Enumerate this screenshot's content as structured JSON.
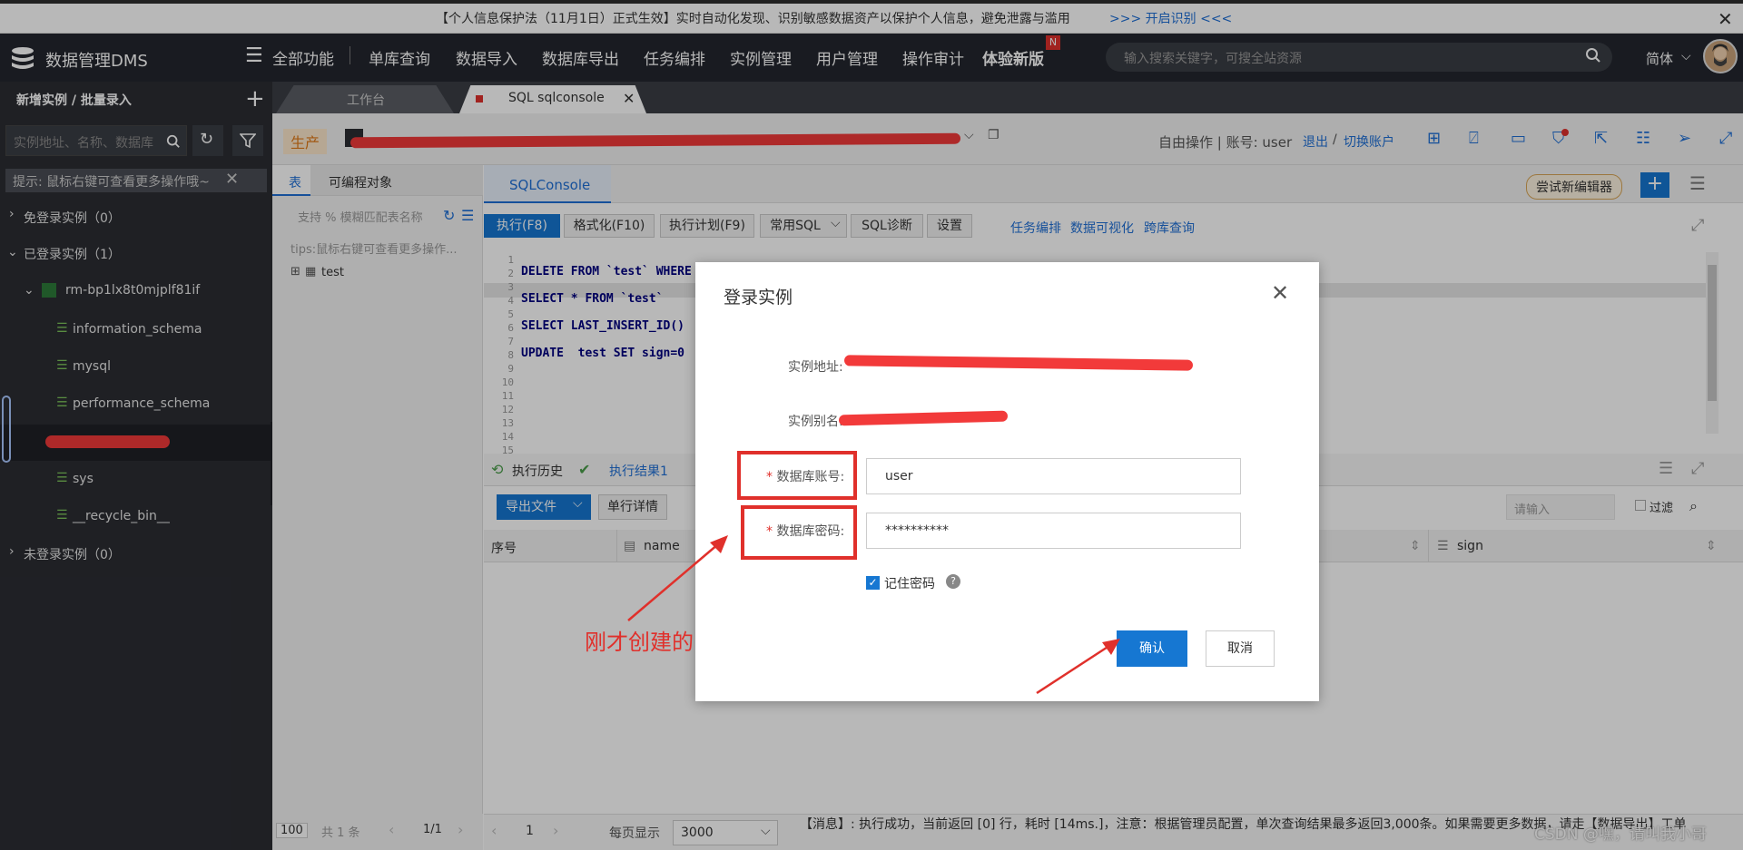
{
  "notice": {
    "text": "【个人信息保护法（11月1日）正式生效】实时自动化发现、识别敏感数据资产以保护个人信息，避免泄露与滥用",
    "link": ">>> 开启识别 <<<"
  },
  "header": {
    "app_title": "数据管理DMS",
    "all_functions": "全部功能",
    "nav": [
      "单库查询",
      "数据导入",
      "数据库导出",
      "任务编排",
      "实例管理",
      "用户管理",
      "操作审计"
    ],
    "try_new": "体验新版",
    "new_badge": "N",
    "search_placeholder": "输入搜索关键字，可搜全站资源",
    "lang": "简体"
  },
  "sidebar": {
    "title": "新增实例 / 批量录入",
    "search_placeholder": "实例地址、名称、数据库",
    "tip": "提示: 鼠标右键可查看更多操作哦~",
    "groups": [
      {
        "label": "免登录实例（0）"
      },
      {
        "label": "已登录实例（1）"
      },
      {
        "label": "未登录实例（0）"
      }
    ],
    "instance": "rm-bp1lx8t0mjplf81if",
    "databases": [
      "information_schema",
      "mysql",
      "performance_schema",
      "sys",
      "__recycle_bin__"
    ]
  },
  "tabs": {
    "workbench": "工作台",
    "sqlconsole": "SQL sqlconsole"
  },
  "infobar": {
    "env": "生产",
    "mode": "自由操作 | 账号: user",
    "logout": "退出",
    "switch": "切换账户"
  },
  "leftpanel": {
    "tab_table": "表",
    "tab_programmable": "可编程对象",
    "search_placeholder": "支持 % 模糊匹配表名称",
    "tips": "tips:鼠标右键可查看更多操作...",
    "tables": [
      "test"
    ]
  },
  "editor": {
    "tab": "SQLConsole",
    "try_new_editor": "尝试新编辑器",
    "toolbar": {
      "execute": "执行(F8)",
      "format": "格式化(F10)",
      "plan": "执行计划(F9)",
      "common_sql": "常用SQL",
      "diagnose": "SQL诊断",
      "settings": "设置",
      "links": [
        "任务编排",
        "数据可视化",
        "跨库查询"
      ]
    },
    "line_numbers": [
      "1",
      "2",
      "3",
      "4",
      "5",
      "6",
      "7",
      "8",
      "9",
      "10",
      "11",
      "12",
      "13",
      "14",
      "15"
    ],
    "lines": [
      "DELETE FROM `test` WHERE",
      "SELECT * FROM `test`",
      "SELECT LAST_INSERT_ID()",
      "UPDATE  test SET sign=0"
    ]
  },
  "results": {
    "history": "执行历史",
    "result1": "执行结果1",
    "export": "导出文件",
    "detail": "单行详情",
    "filter_placeholder": "请输入",
    "filter_label": "过滤",
    "columns": [
      "序号",
      "name",
      "sign"
    ]
  },
  "footer": {
    "page_size": "100",
    "total": "共 1 条",
    "page": "1/1",
    "page_num": "1",
    "per_page_label": "每页显示",
    "per_page": "3000",
    "message": "【消息】: 执行成功，当前返回 [0] 行，耗时 [14ms.]，注意：根据管理员配置，单次查询结果最多返回3,000条。如果需要更多数据，请走【数据导出】工单",
    "watermark": "CSDN @嘿，请叫我小哥"
  },
  "modal": {
    "title": "登录实例",
    "instance_address_label": "实例地址:",
    "instance_alias_label": "实例别名:",
    "db_account_label": "数据库账号:",
    "db_account_value": "user",
    "db_password_label": "数据库密码:",
    "db_password_value": "**********",
    "remember_label": "记住密码",
    "confirm": "确认",
    "cancel": "取消"
  },
  "annotation": {
    "text": "刚才创建的"
  },
  "colors": {
    "accent": "#1677d2",
    "annotation_red": "#e0302b",
    "dark_nav": "#23262e"
  }
}
